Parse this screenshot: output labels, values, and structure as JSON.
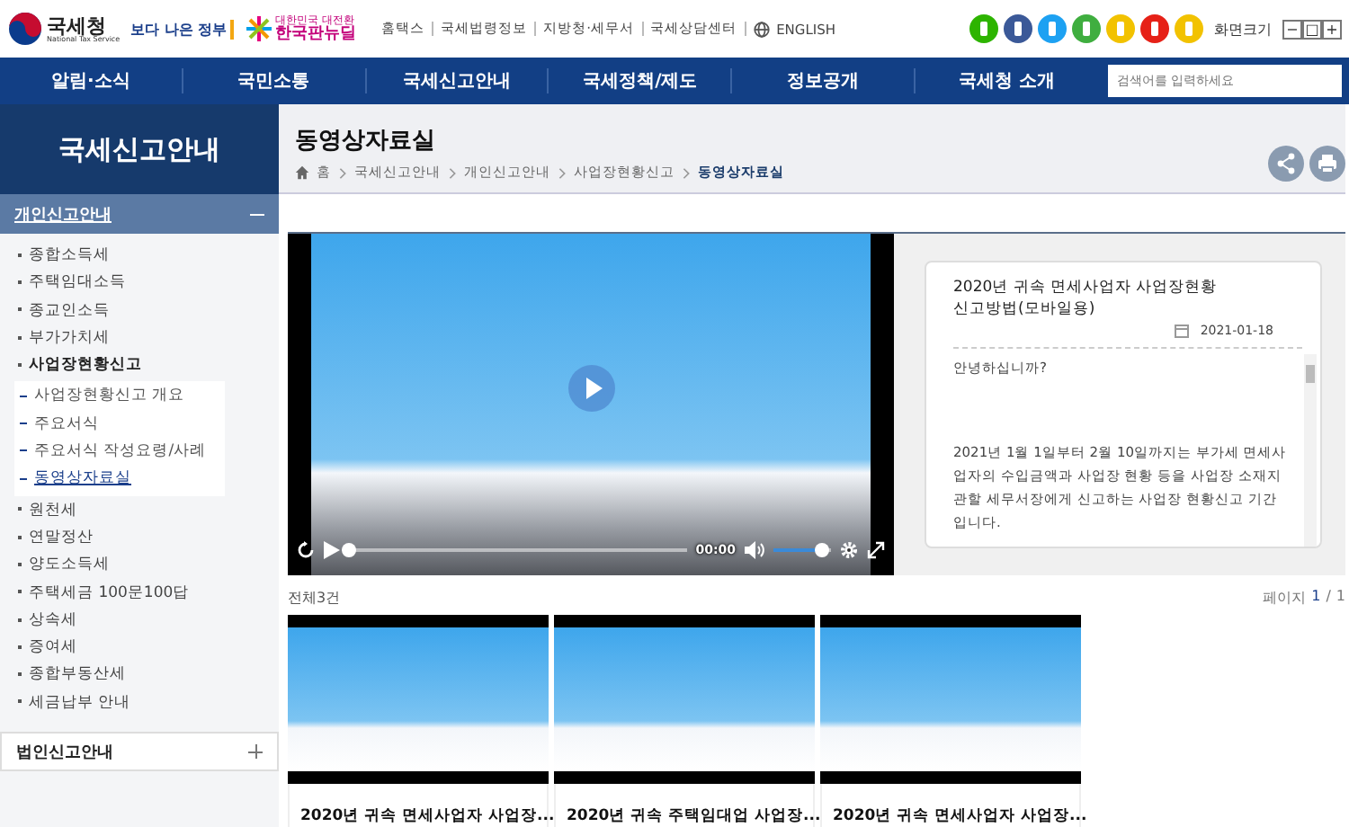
{
  "header": {
    "logo": {
      "name": "국세청",
      "sub": "National Tax Service"
    },
    "gov_logo": "보다 나은 정부",
    "newdeal": {
      "small": "대한민국 대전환",
      "main": "한국판뉴딜"
    },
    "utility_links": [
      "홈택스",
      "국세법령정보",
      "지방청·세무서",
      "국세상담센터",
      "ENGLISH"
    ],
    "font_size": {
      "label": "화면크기",
      "buttons": [
        "−",
        "□",
        "+"
      ]
    }
  },
  "nav": {
    "items": [
      "알림·소식",
      "국민소통",
      "국세신고안내",
      "국세정책/제도",
      "정보공개",
      "국세청 소개"
    ],
    "search": {
      "placeholder": "검색어를 입력하세요"
    }
  },
  "sidebar": {
    "title": "국세신고안내",
    "sections": [
      {
        "label": "개인신고안내",
        "expanded": true,
        "items": [
          {
            "label": "종합소득세",
            "selected": false
          },
          {
            "label": "주택임대소득",
            "selected": false
          },
          {
            "label": "종교인소득",
            "selected": false
          },
          {
            "label": "부가가치세",
            "selected": false
          },
          {
            "label": "사업장현황신고",
            "selected": true,
            "children": [
              {
                "label": "사업장현황신고 개요",
                "selected": false
              },
              {
                "label": "주요서식",
                "selected": false
              },
              {
                "label": "주요서식 작성요령/사례",
                "selected": false
              },
              {
                "label": "동영상자료실",
                "selected": true
              }
            ]
          },
          {
            "label": "원천세",
            "selected": false
          },
          {
            "label": "연말정산",
            "selected": false
          },
          {
            "label": "양도소득세",
            "selected": false
          },
          {
            "label": "주택세금 100문100답",
            "selected": false
          },
          {
            "label": "상속세",
            "selected": false
          },
          {
            "label": "증여세",
            "selected": false
          },
          {
            "label": "종합부동산세",
            "selected": false
          },
          {
            "label": "세금납부 안내",
            "selected": false
          }
        ]
      },
      {
        "label": "법인신고안내",
        "expanded": false
      }
    ]
  },
  "page": {
    "title": "동영상자료실",
    "breadcrumbs": [
      "홈",
      "국세신고안내",
      "개인신고안내",
      "사업장현황신고",
      "동영상자료실"
    ]
  },
  "player": {
    "time": "00:00",
    "progress": {
      "level": 0
    },
    "volume": {
      "level": 0.85
    }
  },
  "description": {
    "title": "2020년 귀속 면세사업자 사업장현황신고방법(모바일용)",
    "date": "2021-01-18",
    "paragraphs": [
      "안녕하십니까?",
      "2021년 1월 1일부터 2월 10일까지는 부가세 면세사업자의 수입금액과 사업장 현황 등을 사업장 소재지 관할 세무서장에게 신고하는 사업장 현황신고 기간입니다."
    ]
  },
  "list": {
    "total": "전체3건",
    "page_label": "페이지",
    "page_current": "1",
    "page_sep": "/",
    "page_total": "1",
    "videos": [
      {
        "title": "2020년 귀속 면세사업자 사업장..."
      },
      {
        "title": "2020년 귀속 주택임대업 사업장..."
      },
      {
        "title": "2020년 귀속 면세사업자 사업장..."
      }
    ]
  }
}
